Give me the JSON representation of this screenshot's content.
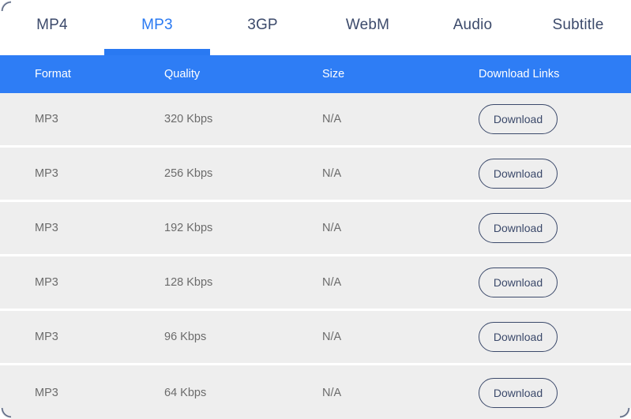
{
  "tabs": {
    "items": [
      {
        "label": "MP4",
        "active": false
      },
      {
        "label": "MP3",
        "active": true
      },
      {
        "label": "3GP",
        "active": false
      },
      {
        "label": "WebM",
        "active": false
      },
      {
        "label": "Audio",
        "active": false
      },
      {
        "label": "Subtitle",
        "active": false
      }
    ],
    "active_index": 1
  },
  "table": {
    "columns": [
      {
        "key": "format",
        "label": "Format"
      },
      {
        "key": "quality",
        "label": "Quality"
      },
      {
        "key": "size",
        "label": "Size"
      },
      {
        "key": "links",
        "label": "Download Links"
      }
    ],
    "rows": [
      {
        "format": "MP3",
        "quality": "320 Kbps",
        "size": "N/A",
        "action": "Download"
      },
      {
        "format": "MP3",
        "quality": "256 Kbps",
        "size": "N/A",
        "action": "Download"
      },
      {
        "format": "MP3",
        "quality": "192 Kbps",
        "size": "N/A",
        "action": "Download"
      },
      {
        "format": "MP3",
        "quality": "128 Kbps",
        "size": "N/A",
        "action": "Download"
      },
      {
        "format": "MP3",
        "quality": "96 Kbps",
        "size": "N/A",
        "action": "Download"
      },
      {
        "format": "MP3",
        "quality": "64 Kbps",
        "size": "N/A",
        "action": "Download"
      }
    ]
  },
  "colors": {
    "accent": "#2979f2",
    "header_bg": "#2e7df5",
    "row_bg": "#eeeeee",
    "row_divider": "#ffffff",
    "text_muted": "#6b6b6b",
    "text_dark": "#3c4a6b",
    "button_border": "#3c4a6b"
  }
}
